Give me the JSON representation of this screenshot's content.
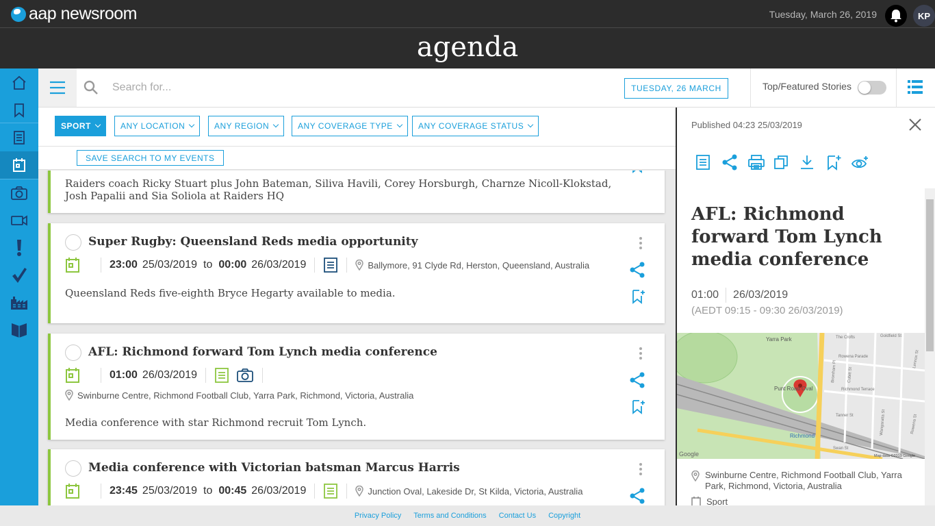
{
  "header": {
    "logo_text": "aap newsroom",
    "date": "Tuesday, March 26, 2019",
    "user_initials": "KP",
    "section_title": "agenda"
  },
  "toolbar": {
    "search_placeholder": "Search for...",
    "date_button": "TUESDAY, 26 MARCH",
    "featured_label": "Top/Featured Stories",
    "featured_on": false
  },
  "filters": {
    "chips": [
      "SPORT",
      "ANY LOCATION",
      "ANY REGION",
      "ANY COVERAGE TYPE",
      "ANY COVERAGE STATUS"
    ],
    "save_search": "SAVE SEARCH TO MY EVENTS"
  },
  "events": [
    {
      "description": "Raiders coach Ricky Stuart plus John Bateman, Siliva Havili, Corey Horsburgh, Charnze Nicoll-Klokstad, Josh Papalii and Sia Soliola at Raiders HQ"
    },
    {
      "title": "Super Rugby: Queensland Reds media opportunity",
      "start_time": "23:00",
      "start_date": "25/03/2019",
      "to": "to",
      "end_time": "00:00",
      "end_date": "26/03/2019",
      "location": "Ballymore, 91 Clyde Rd, Herston, Queensland, Australia",
      "description": "Queensland Reds five-eighth Bryce Hegarty available to media."
    },
    {
      "title": "AFL: Richmond forward Tom Lynch media conference",
      "start_time": "01:00",
      "start_date": "26/03/2019",
      "location": "Swinburne Centre, Richmond Football Club, Yarra Park, Richmond, Victoria, Australia",
      "description": "Media conference with star Richmond recruit Tom Lynch."
    },
    {
      "title": "Media conference with Victorian batsman Marcus Harris",
      "start_time": "23:45",
      "start_date": "25/03/2019",
      "to": "to",
      "end_time": "00:45",
      "end_date": "26/03/2019",
      "location": "Junction Oval, Lakeside Dr, St Kilda, Victoria, Australia"
    }
  ],
  "detail": {
    "published": "Published 04:23 25/03/2019",
    "title": "AFL: Richmond forward Tom Lynch media conference",
    "time": "01:00",
    "date": "26/03/2019",
    "aedt": "(AEDT 09:15 - 09:30 26/03/2019)",
    "location": "Swinburne Centre, Richmond Football Club, Yarra Park, Richmond, Victoria, Australia",
    "category": "Sport",
    "map": {
      "labels": [
        "Yarra Park",
        "Punt Road Oval",
        "Richmond",
        "The Crofts",
        "Goldfield St",
        "Lennox St",
        "Rowena Parade",
        "Bromham Pl",
        "Cubitt St",
        "Richmond Terrace",
        "Tanner St",
        "Wangaratta St",
        "Rowena St",
        "Swan St"
      ],
      "google": "Google",
      "credit": "Map data ©2019 Google"
    }
  },
  "footer": {
    "links": [
      "Privacy Policy",
      "Terms and Conditions",
      "Contact Us",
      "Copyright"
    ]
  },
  "colors": {
    "accent": "#1a9fdb",
    "event_bar": "#8dc63f",
    "header_bg": "#2c2c2c"
  }
}
